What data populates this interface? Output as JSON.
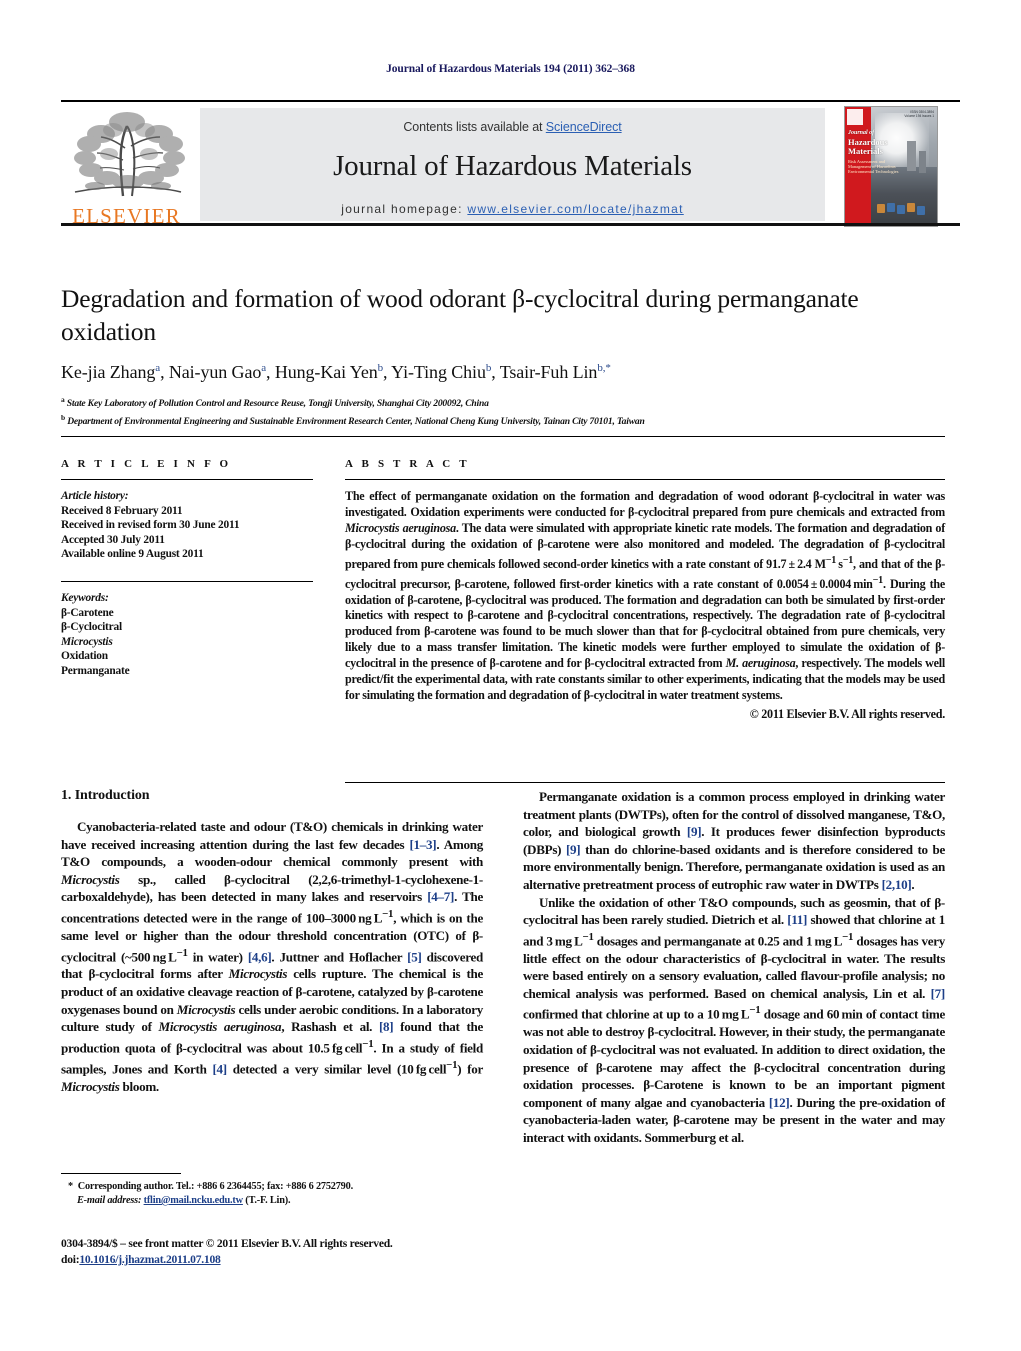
{
  "running_head": "Journal of Hazardous Materials 194 (2011) 362–368",
  "masthead": {
    "contents_prefix": "Contents lists available at ",
    "contents_link": "ScienceDirect",
    "journal_title": "Journal of Hazardous Materials",
    "homepage_prefix": "journal homepage: ",
    "homepage_url": "www.elsevier.com/locate/jhazmat",
    "publisher": "ELSEVIER",
    "cover": {
      "title_line1": "Journal of",
      "title_line2": "Hazardous",
      "title_line3": "Materials",
      "subtitle": "Risk Assessment and Management of Hazardous Environmental Technologies",
      "topright": "ISSN 0304-3894  Volume 194  Issues 1"
    },
    "accent_link_color": "#2b5fb3",
    "elsevier_orange": "#e87722",
    "band_bg": "#e7e8ea"
  },
  "article": {
    "title": "Degradation and formation of wood odorant β-cyclocitral during permanganate oxidation",
    "authors_html": "Ke-jia Zhang<sup>a</sup>, Nai-yun Gao<sup>a</sup>, Hung-Kai Yen<sup>b</sup>, Yi-Ting Chiu<sup>b</sup>, Tsair-Fuh Lin<sup>b,</sup><sup>*</sup>",
    "affiliations": [
      "State Key Laboratory of Pollution Control and Resource Reuse, Tongji University, Shanghai City 200092, China",
      "Department of Environmental Engineering and Sustainable Environment Research Center, National Cheng Kung University, Tainan City 70101, Taiwan"
    ],
    "affiliation_marks": [
      "a",
      "b"
    ]
  },
  "article_info": {
    "label": "A R T I C L E    I N F O",
    "history_label": "Article history:",
    "history": [
      "Received 8 February 2011",
      "Received in revised form 30 June 2011",
      "Accepted 30 July 2011",
      "Available online 9 August 2011"
    ],
    "keywords_label": "Keywords:",
    "keywords": [
      "β-Carotene",
      "β-Cyclocitral",
      "Microcystis",
      "Oxidation",
      "Permanganate"
    ],
    "keywords_italic_index": 2
  },
  "abstract": {
    "label": "A B S T R A C T",
    "text_html": "The effect of permanganate oxidation on the formation and degradation of wood odorant β-cyclocitral in water was investigated. Oxidation experiments were conducted for β-cyclocitral prepared from pure chemicals and extracted from <span class=\"it\">Microcystis aeruginosa</span>. The data were simulated with appropriate kinetic rate models. The formation and degradation of β-cyclocitral during the oxidation of β-carotene were also monitored and modeled. The degradation of β-cyclocitral prepared from pure chemicals followed second-order kinetics with a rate constant of 91.7&#8201;±&#8201;2.4 M<sup>−1</sup>&#8201;s<sup>−1</sup>, and that of the β-cyclocitral precursor, β-carotene, followed first-order kinetics with a rate constant of 0.0054&#8201;±&#8201;0.0004&#8201;min<sup>−1</sup>. During the oxidation of β-carotene, β-cyclocitral was produced. The formation and degradation can both be simulated by first-order kinetics with respect to β-carotene and β-cyclocitral concentrations, respectively. The degradation rate of β-cyclocitral produced from β-carotene was found to be much slower than that for β-cyclocitral obtained from pure chemicals, very likely due to a mass transfer limitation. The kinetic models were further employed to simulate the oxidation of β-cyclocitral in the presence of β-carotene and for β-cyclocitral extracted from <span class=\"it\">M. aeruginosa</span>, respectively. The models well predict/fit the experimental data, with rate constants similar to other experiments, indicating that the models may be used for simulating the formation and degradation of β-cyclocitral in water treatment systems.",
    "copyright": "© 2011 Elsevier B.V. All rights reserved."
  },
  "sections": {
    "intro_heading": "1.  Introduction",
    "left_paragraphs_html": [
      "Cyanobacteria-related taste and odour (T&amp;O) chemicals in drinking water have received increasing attention during the last few decades <span class=\"ref\">[1–3]</span>. Among T&amp;O compounds, a wooden-odour chemical commonly present with <span class=\"it\">Microcystis</span> sp., called β-cyclocitral (2,2,6-trimethyl-1-cyclohexene-1-carboxaldehyde), has been detected in many lakes and reservoirs <span class=\"ref\">[4–7]</span>. The concentrations detected were in the range of 100–3000&#8201;ng&#8201;L<sup>−1</sup>, which is on the same level or higher than the odour threshold concentration (OTC) of β-cyclocitral (~500&#8201;ng&#8201;L<sup>−1</sup> in water) <span class=\"ref\">[4,6]</span>. Juttner and Hoflacher <span class=\"ref\">[5]</span> discovered that β-cyclocitral forms after <span class=\"it\">Microcystis</span> cells rupture. The chemical is the product of an oxidative cleavage reaction of β-carotene, catalyzed by β-carotene oxygenases bound on <span class=\"it\">Microcystis</span> cells under aerobic conditions. In a laboratory culture study of <span class=\"it\">Microcystis aeruginosa</span>, Rashash et al. <span class=\"ref\">[8]</span> found that the production quota of β-cyclocitral was about 10.5&#8201;fg&#8201;cell<sup>−1</sup>. In a study of field samples, Jones and Korth <span class=\"ref\">[4]</span> detected a very similar level (10&#8201;fg&#8201;cell<sup>−1</sup>) for <span class=\"it\">Microcystis</span> bloom."
    ],
    "right_paragraphs_html": [
      "Permanganate oxidation is a common process employed in drinking water treatment plants (DWTPs), often for the control of dissolved manganese, T&amp;O, color, and biological growth <span class=\"ref\">[9]</span>. It produces fewer disinfection byproducts (DBPs) <span class=\"ref\">[9]</span> than do chlorine-based oxidants and is therefore considered to be more environmentally benign. Therefore, permanganate oxidation is used as an alternative pretreatment process of eutrophic raw water in DWTPs <span class=\"ref\">[2,10]</span>.",
      "Unlike the oxidation of other T&amp;O compounds, such as geosmin, that of β-cyclocitral has been rarely studied. Dietrich et al. <span class=\"ref\">[11]</span> showed that chlorine at 1 and 3&#8201;mg&#8201;L<sup>−1</sup> dosages and permanganate at 0.25 and 1&#8201;mg&#8201;L<sup>−1</sup> dosages has very little effect on the odour characteristics of β-cyclocitral in water. The results were based entirely on a sensory evaluation, called flavour-profile analysis; no chemical analysis was performed. Based on chemical analysis, Lin et al. <span class=\"ref\">[7]</span> confirmed that chlorine at up to a 10&#8201;mg&#8201;L<sup>−1</sup> dosage and 60&#8201;min of contact time was not able to destroy β-cyclocitral. However, in their study, the permanganate oxidation of β-cyclocitral was not evaluated. In addition to direct oxidation, the presence of β-carotene may affect the β-cyclocitral concentration during oxidation processes. β-Carotene is known to be an important pigment component of many algae and cyanobacteria <span class=\"ref\">[12]</span>. During the pre-oxidation of cyanobacteria-laden water, β-carotene may be present in the water and may interact with oxidants. Sommerburg et al."
    ]
  },
  "footnote": {
    "corresponding_html": "<span style=\"font-weight:bold\">*</span>&nbsp; Corresponding author. Tel.: +886 6 2364455; fax: +886 6 2752790.",
    "email_label": "E-mail address:",
    "email": "tflin@mail.ncku.edu.tw",
    "email_suffix": "(T.-F. Lin)."
  },
  "footer": {
    "front_matter": "0304-3894/$ – see front matter © 2011 Elsevier B.V. All rights reserved.",
    "doi_label": "doi:",
    "doi": "10.1016/j.jhazmat.2011.07.108"
  }
}
